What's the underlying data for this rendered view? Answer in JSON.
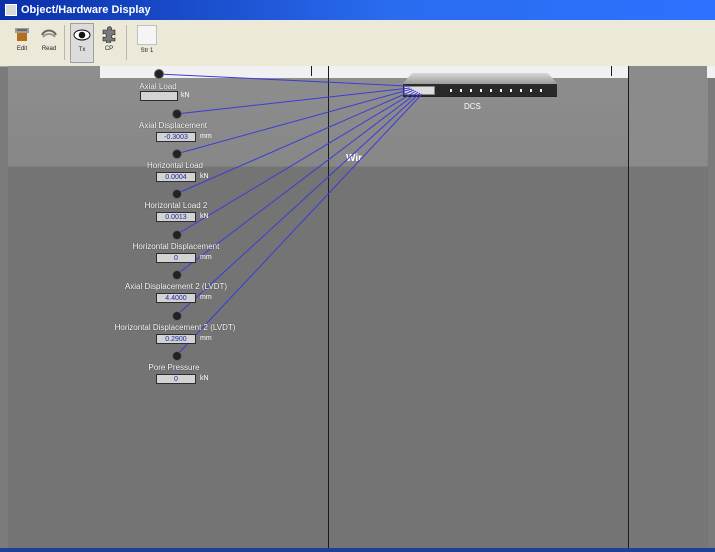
{
  "window": {
    "title": "Object/Hardware Display"
  },
  "toolbar": {
    "buttons": [
      {
        "label": "Edit",
        "icon": "edit-icon"
      },
      {
        "label": "Read",
        "icon": "read-icon"
      },
      {
        "label": "Tx",
        "icon": "eye-icon"
      },
      {
        "label": "CP",
        "icon": "puzzle-icon"
      },
      {
        "label": "Str 1",
        "icon": "blank-icon"
      }
    ]
  },
  "diagram": {
    "device_name": "DCS",
    "channels": [
      {
        "label": "Axial Load",
        "value": "",
        "unit": "kN"
      },
      {
        "label": "Axial Displacement",
        "value": "-0.3003",
        "unit": "mm"
      },
      {
        "label": "Horizontal Load",
        "value": "0.0004",
        "unit": "kN"
      },
      {
        "label": "Horizontal Load 2",
        "value": "0.0013",
        "unit": "kN"
      },
      {
        "label": "Horizontal Displacement",
        "value": "0",
        "unit": "mm"
      },
      {
        "label": "Axial Displacement 2 (LVDT)",
        "value": "4.4000",
        "unit": "mm"
      },
      {
        "label": "Horizontal Displacement 2 (LVDT)",
        "value": "0.2900",
        "unit": "mm"
      },
      {
        "label": "Pore Pressure",
        "value": "0",
        "unit": "kN"
      }
    ],
    "overlay_text": "Wir"
  }
}
